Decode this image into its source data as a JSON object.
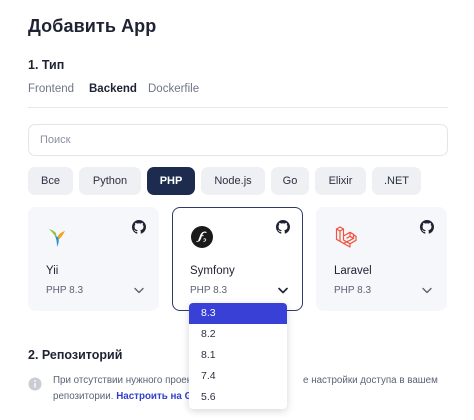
{
  "page": {
    "title": "Добавить App"
  },
  "section1": {
    "title": "1. Тип"
  },
  "tabs": [
    {
      "label": "Frontend",
      "active": false
    },
    {
      "label": "Backend",
      "active": true
    },
    {
      "label": "Dockerfile",
      "active": false
    }
  ],
  "search": {
    "placeholder": "Поиск",
    "value": ""
  },
  "chips": [
    {
      "label": "Все",
      "active": false
    },
    {
      "label": "Python",
      "active": false
    },
    {
      "label": "PHP",
      "active": true
    },
    {
      "label": "Node.js",
      "active": false
    },
    {
      "label": "Go",
      "active": false
    },
    {
      "label": "Elixir",
      "active": false
    },
    {
      "label": ".NET",
      "active": false
    }
  ],
  "cards": [
    {
      "name": "Yii",
      "version": "PHP 8.3",
      "logo": "yii-logo",
      "selected": false
    },
    {
      "name": "Symfony",
      "version": "PHP 8.3",
      "logo": "symfony-logo",
      "selected": true
    },
    {
      "name": "Laravel",
      "version": "PHP 8.3",
      "logo": "laravel-logo",
      "selected": false
    }
  ],
  "version_dropdown": {
    "options": [
      "8.3",
      "8.2",
      "8.1",
      "7.4",
      "5.6"
    ],
    "selected": "8.3"
  },
  "section2": {
    "title": "2. Репозиторий",
    "info_line1": "При отсутствии нужного проек",
    "info_line1_tail": "е настройки доступа в вашем",
    "info_line2": "репозитории.",
    "info_link": "Настроить на Git"
  },
  "colors": {
    "accent": "#3840d6",
    "chip_active": "#1c2b4e",
    "card_border_selected": "#2f3a6b",
    "link": "#3540c8",
    "laravel": "#f0533f",
    "symfony": "#1a1a1a"
  }
}
